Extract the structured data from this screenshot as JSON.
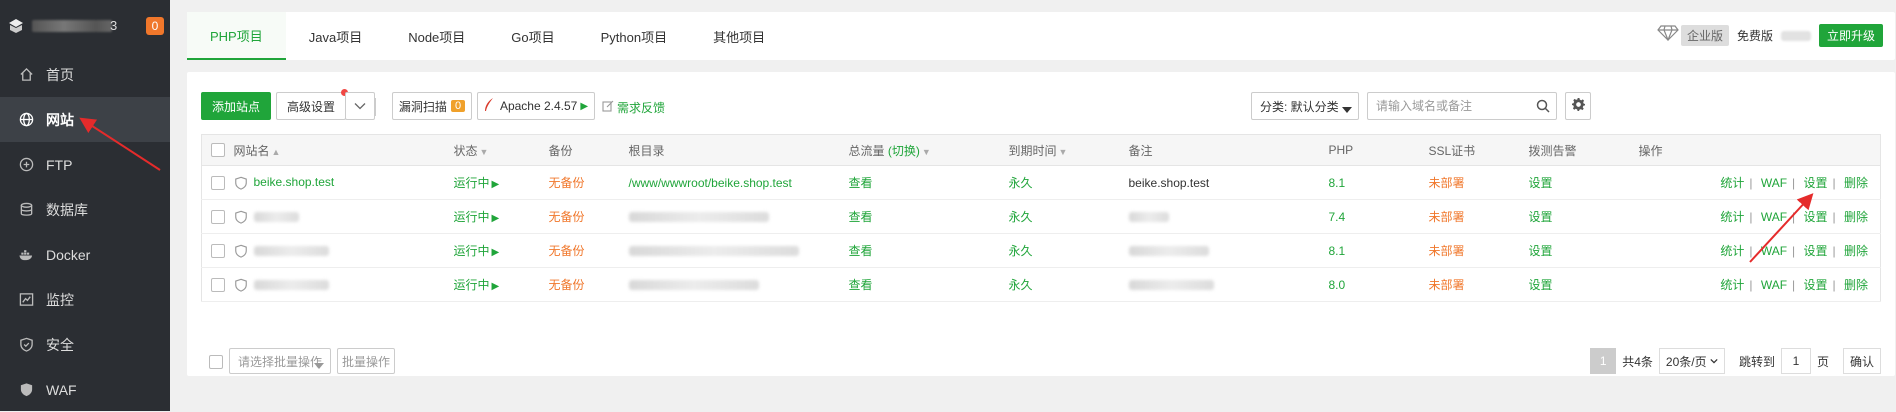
{
  "sidebar": {
    "host_suffix": "3",
    "badge": "0",
    "items": [
      {
        "label": "首页",
        "icon": "home-icon"
      },
      {
        "label": "网站",
        "icon": "globe-icon",
        "active": true
      },
      {
        "label": "FTP",
        "icon": "ftp-icon"
      },
      {
        "label": "数据库",
        "icon": "database-icon"
      },
      {
        "label": "Docker",
        "icon": "docker-icon"
      },
      {
        "label": "监控",
        "icon": "monitor-icon"
      },
      {
        "label": "安全",
        "icon": "shield-icon"
      },
      {
        "label": "WAF",
        "icon": "waf-icon"
      }
    ]
  },
  "tabs": [
    "PHP项目",
    "Java项目",
    "Node项目",
    "Go项目",
    "Python项目",
    "其他项目"
  ],
  "header": {
    "enterprise_label": "企业版",
    "free_label": "免费版",
    "upgrade_label": "立即升级"
  },
  "toolbar": {
    "add_site": "添加站点",
    "advanced": "高级设置",
    "scan": "漏洞扫描",
    "scan_count": "0",
    "apache": "Apache 2.4.57",
    "feedback": "需求反馈",
    "category": "分类: 默认分类",
    "search_placeholder": "请输入域名或备注"
  },
  "table": {
    "headers": {
      "name": "网站名",
      "status": "状态",
      "backup": "备份",
      "root": "根目录",
      "traffic": "总流量",
      "traffic_switch": "(切换)",
      "expire": "到期时间",
      "note": "备注",
      "php": "PHP",
      "ssl": "SSL证书",
      "alert": "拨测告警",
      "ops": "操作"
    },
    "rows": [
      {
        "name": "beike.shop.test",
        "status": "运行中",
        "backup": "无备份",
        "root": "/www/wwwroot/beike.shop.test",
        "traffic": "查看",
        "expire": "永久",
        "note": "beike.shop.test",
        "php": "8.1",
        "ssl": "未部署",
        "alert": "设置"
      },
      {
        "name": "",
        "status": "运行中",
        "backup": "无备份",
        "root": "",
        "traffic": "查看",
        "expire": "永久",
        "note": "",
        "php": "7.4",
        "ssl": "未部署",
        "alert": "设置"
      },
      {
        "name": "",
        "status": "运行中",
        "backup": "无备份",
        "root": "",
        "traffic": "查看",
        "expire": "永久",
        "note": "",
        "php": "8.1",
        "ssl": "未部署",
        "alert": "设置"
      },
      {
        "name": "",
        "status": "运行中",
        "backup": "无备份",
        "root": "",
        "traffic": "查看",
        "expire": "永久",
        "note": "",
        "php": "8.0",
        "ssl": "未部署",
        "alert": "设置"
      }
    ],
    "ops": [
      "统计",
      "WAF",
      "设置",
      "删除"
    ]
  },
  "footer": {
    "batch_placeholder": "请选择批量操作",
    "batch_button": "批量操作",
    "current_page": "1",
    "total": "共4条",
    "per_page": "20条/页",
    "jump_label": "跳转到",
    "jump_value": "1",
    "page_unit": "页",
    "confirm": "确认"
  },
  "colors": {
    "accent": "#20a53a",
    "warning": "#f0772b",
    "sidebar_bg": "#2b2e33",
    "annotation": "#e52b2b"
  }
}
